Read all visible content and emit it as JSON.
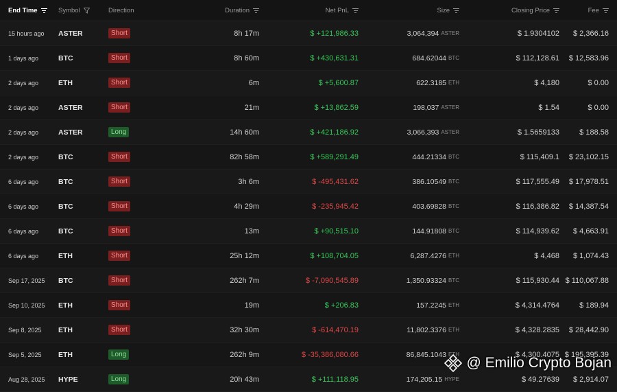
{
  "header": {
    "end_time": "End Time",
    "symbol": "Symbol",
    "direction": "Direction",
    "duration": "Duration",
    "net_pnl": "Net PnL",
    "size": "Size",
    "closing_price": "Closing Price",
    "fee": "Fee"
  },
  "rows": [
    {
      "time": "15 hours ago",
      "symbol": "ASTER",
      "direction": "Short",
      "duration": "8h 17m",
      "pnl": "$ +121,986.33",
      "size": "3,064,394",
      "unit": "ASTER",
      "close": "$ 1.9304102",
      "fee": "$ 2,366.16"
    },
    {
      "time": "1 days ago",
      "symbol": "BTC",
      "direction": "Short",
      "duration": "8h 60m",
      "pnl": "$ +430,631.31",
      "size": "684.62044",
      "unit": "BTC",
      "close": "$ 112,128.61",
      "fee": "$ 12,583.96"
    },
    {
      "time": "2 days ago",
      "symbol": "ETH",
      "direction": "Short",
      "duration": "6m",
      "pnl": "$ +5,600.87",
      "size": "622.3185",
      "unit": "ETH",
      "close": "$ 4,180",
      "fee": "$ 0.00"
    },
    {
      "time": "2 days ago",
      "symbol": "ASTER",
      "direction": "Short",
      "duration": "21m",
      "pnl": "$ +13,862.59",
      "size": "198,037",
      "unit": "ASTER",
      "close": "$ 1.54",
      "fee": "$ 0.00"
    },
    {
      "time": "2 days ago",
      "symbol": "ASTER",
      "direction": "Long",
      "duration": "14h 60m",
      "pnl": "$ +421,186.92",
      "size": "3,066,393",
      "unit": "ASTER",
      "close": "$ 1.5659133",
      "fee": "$ 188.58"
    },
    {
      "time": "2 days ago",
      "symbol": "BTC",
      "direction": "Short",
      "duration": "82h 58m",
      "pnl": "$ +589,291.49",
      "size": "444.21334",
      "unit": "BTC",
      "close": "$ 115,409.1",
      "fee": "$ 23,102.15"
    },
    {
      "time": "6 days ago",
      "symbol": "BTC",
      "direction": "Short",
      "duration": "3h 6m",
      "pnl": "$ -495,431.62",
      "size": "386.10549",
      "unit": "BTC",
      "close": "$ 117,555.49",
      "fee": "$ 17,978.51"
    },
    {
      "time": "6 days ago",
      "symbol": "BTC",
      "direction": "Short",
      "duration": "4h 29m",
      "pnl": "$ -235,945.42",
      "size": "403.69828",
      "unit": "BTC",
      "close": "$ 116,386.82",
      "fee": "$ 14,387.54"
    },
    {
      "time": "6 days ago",
      "symbol": "BTC",
      "direction": "Short",
      "duration": "13m",
      "pnl": "$ +90,515.10",
      "size": "144.91808",
      "unit": "BTC",
      "close": "$ 114,939.62",
      "fee": "$ 4,663.91"
    },
    {
      "time": "6 days ago",
      "symbol": "ETH",
      "direction": "Short",
      "duration": "25h 12m",
      "pnl": "$ +108,704.05",
      "size": "6,287.4276",
      "unit": "ETH",
      "close": "$ 4,468",
      "fee": "$ 1,074.43"
    },
    {
      "time": "Sep 17, 2025",
      "symbol": "BTC",
      "direction": "Short",
      "duration": "262h 7m",
      "pnl": "$ -7,090,545.89",
      "size": "1,350.93324",
      "unit": "BTC",
      "close": "$ 115,930.44",
      "fee": "$ 110,067.88"
    },
    {
      "time": "Sep 10, 2025",
      "symbol": "ETH",
      "direction": "Short",
      "duration": "19m",
      "pnl": "$ +206.83",
      "size": "157.2245",
      "unit": "ETH",
      "close": "$ 4,314.4764",
      "fee": "$ 189.94"
    },
    {
      "time": "Sep 8, 2025",
      "symbol": "ETH",
      "direction": "Short",
      "duration": "32h 30m",
      "pnl": "$ -614,470.19",
      "size": "11,802.3376",
      "unit": "ETH",
      "close": "$ 4,328.2835",
      "fee": "$ 28,442.90"
    },
    {
      "time": "Sep 5, 2025",
      "symbol": "ETH",
      "direction": "Long",
      "duration": "262h 9m",
      "pnl": "$ -35,386,080.66",
      "size": "86,845.1043",
      "unit": "ETH",
      "close": "$ 4,300.4075",
      "fee": "$ 195,395.39"
    },
    {
      "time": "Aug 28, 2025",
      "symbol": "HYPE",
      "direction": "Long",
      "duration": "20h 43m",
      "pnl": "$ +111,118.95",
      "size": "174,205.15",
      "unit": "HYPE",
      "close": "$ 49.27639",
      "fee": "$ 2,914.07"
    }
  ],
  "watermark": "@ Emilio Crypto Bojan",
  "colors": {
    "positive": "#38c75a",
    "negative": "#e04848",
    "short_badge": "#7a1f1f",
    "long_badge": "#1f5a2a"
  }
}
